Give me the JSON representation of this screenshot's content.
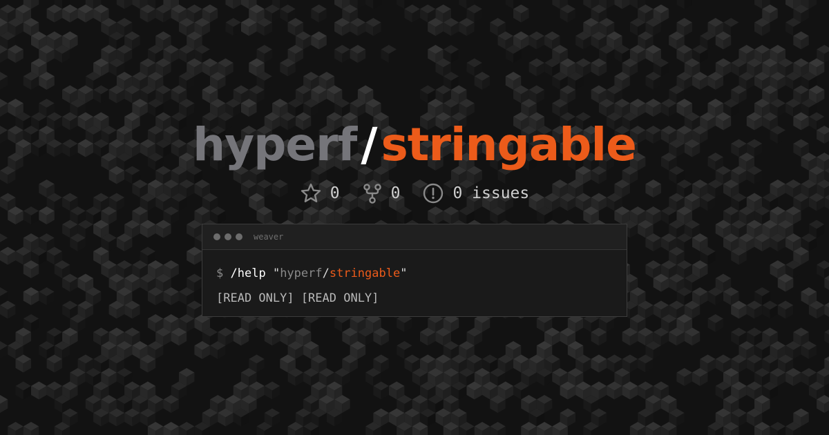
{
  "title": {
    "owner": "hyperf",
    "slash": "/",
    "repo": "stringable"
  },
  "stats": {
    "stars": "0",
    "forks": "0",
    "issues": "0 issues"
  },
  "terminal": {
    "name": "weaver",
    "prompt": "$",
    "command": "/help",
    "quote_open": "\"",
    "arg_owner": "hyperf",
    "arg_slash": "/",
    "arg_repo": "stringable",
    "quote_close": "\"",
    "output": "[READ ONLY] [READ ONLY]"
  },
  "colors": {
    "background": "#121212",
    "accent": "#ec5b1a",
    "owner": "#75757a"
  },
  "icons": [
    "star-icon",
    "fork-icon",
    "issue-icon"
  ]
}
